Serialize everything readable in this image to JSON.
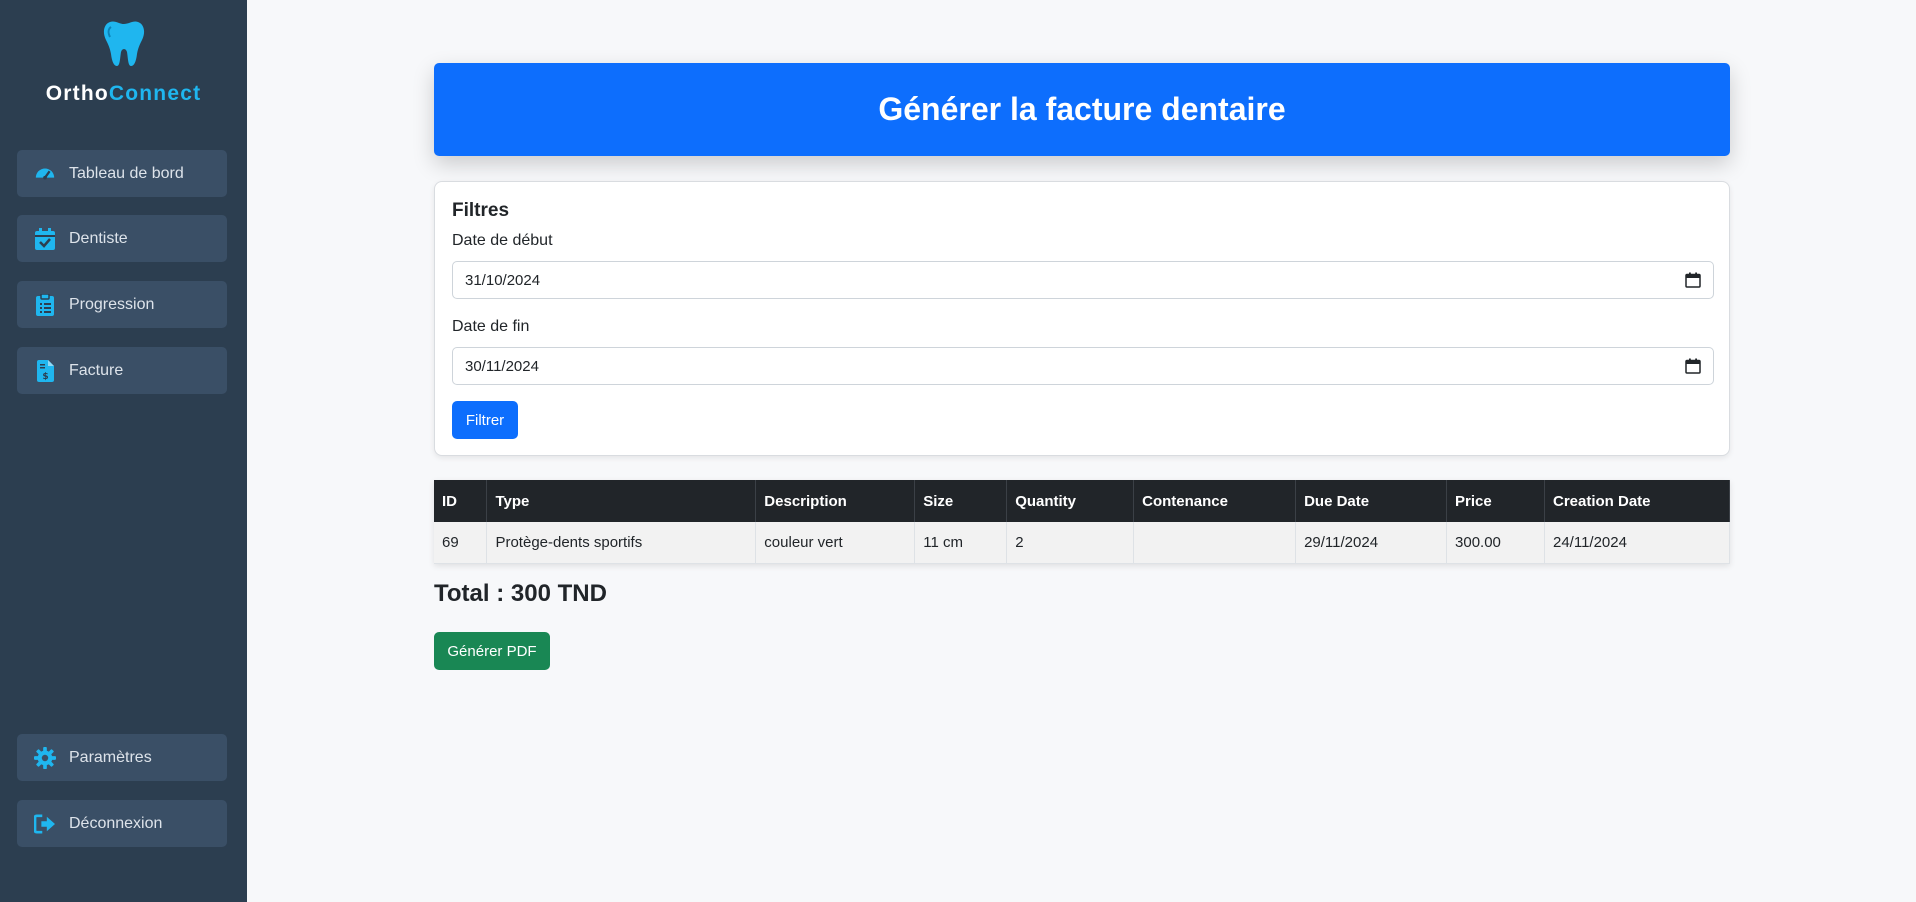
{
  "sidebar": {
    "brand": {
      "part1": "Ortho",
      "part2": "Connect"
    },
    "items": [
      {
        "label": "Tableau de bord",
        "icon": "gauge-icon"
      },
      {
        "label": "Dentiste",
        "icon": "calendar-check-icon"
      },
      {
        "label": "Progression",
        "icon": "clipboard-list-icon"
      },
      {
        "label": "Facture",
        "icon": "invoice-dollar-icon"
      }
    ],
    "bottom_items": [
      {
        "label": "Paramètres",
        "icon": "gear-icon"
      },
      {
        "label": "Déconnexion",
        "icon": "logout-icon"
      }
    ],
    "accent": "#1fb6ef"
  },
  "header": {
    "title": "Générer la facture dentaire"
  },
  "filters": {
    "title": "Filtres",
    "start_label": "Date de début",
    "start_value": "31/10/2024",
    "end_label": "Date de fin",
    "end_value": "30/11/2024",
    "button": "Filtrer"
  },
  "table": {
    "columns": [
      "ID",
      "Type",
      "Description",
      "Size",
      "Quantity",
      "Contenance",
      "Due Date",
      "Price",
      "Creation Date"
    ],
    "rows": [
      [
        "69",
        "Protège-dents sportifs",
        "couleur vert",
        "11 cm",
        "2",
        "",
        "29/11/2024",
        "300.00",
        "24/11/2024"
      ]
    ]
  },
  "total": "Total : 300 TND",
  "pdf_button": "Générer PDF",
  "colors": {
    "primary": "#0d6efd",
    "success": "#198754",
    "sidebar": "#2c3e50"
  }
}
